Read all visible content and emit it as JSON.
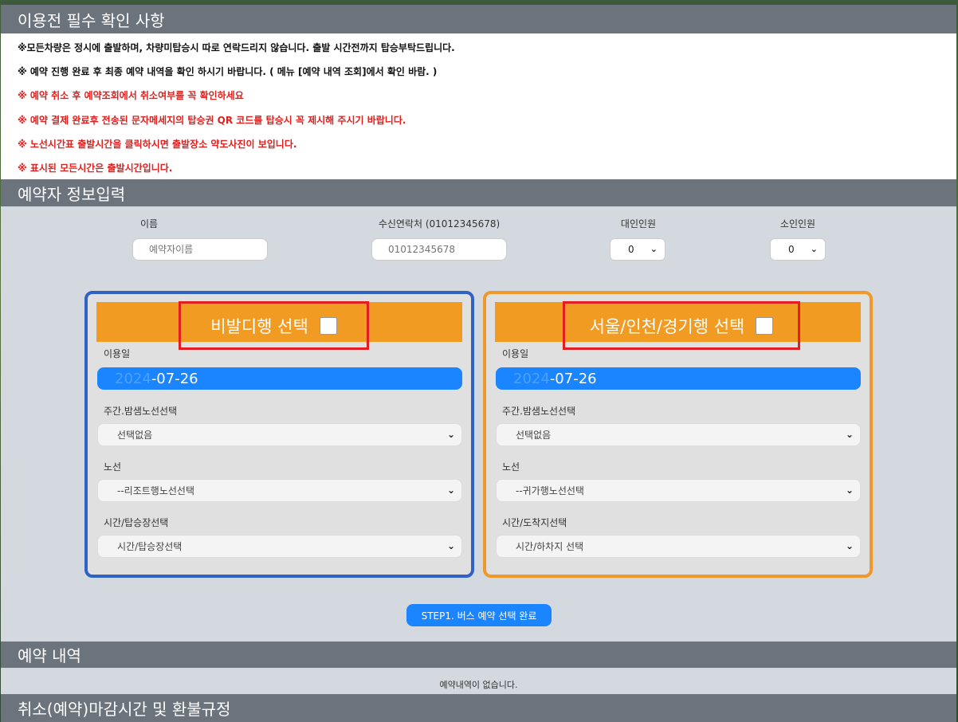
{
  "sections": {
    "notice_title": "이용전 필수 확인 사항",
    "info_title": "예약자 정보입력",
    "history_title": "예약 내역",
    "refund_title": "취소(예약)마감시간 및 환불규정"
  },
  "notices": [
    {
      "text": "※모든차량은 정시에 출발하며, 차량미탑승시 따로 연락드리지 않습니다. 출발 시간전까지 탑승부탁드립니다.",
      "color": "#111111"
    },
    {
      "text": "※ 예약 진행 완료 후 최종 예약 내역을 확인 하시기 바랍니다. ( 메뉴 [예약 내역 조회]에서 확인 바람. )",
      "color": "#111111"
    },
    {
      "text": "※ 예약 취소 후 예약조회에서 취소여부를 꼭 확인하세요",
      "color": "#e0201e"
    },
    {
      "text": "※ 예약 결제 완료후 전송된 문자메세지의 탑승권 QR 코드를 탑승시 꼭 제시해 주시기 바랍니다.",
      "color": "#e0201e"
    },
    {
      "text": "※ 노선시간표 출발시간을 클릭하시면 출발장소 약도사진이 보입니다.",
      "color": "#e0201e"
    },
    {
      "text": "※ 표시된 모든시간은 출발시간입니다.",
      "color": "#e0201e"
    }
  ],
  "form": {
    "name_label": "이름",
    "name_placeholder": "예약자이름",
    "phone_label": "수신연락처 (01012345678)",
    "phone_placeholder": "01012345678",
    "adult_label": "대인인원",
    "adult_value": "0",
    "child_label": "소인인원",
    "child_value": "0"
  },
  "left_box": {
    "title": "비발디행 선택",
    "date_label": "이용일",
    "date_year": "2024",
    "date_rest": "-07-26",
    "day_night_label": "주간.밤샘노선선택",
    "day_night_value": "선택없음",
    "route_label": "노선",
    "route_value": "--리조트행노선선택",
    "time_label": "시간/탑승장선택",
    "time_value": "시간/탑승장선택",
    "border_color": "#2f62c4"
  },
  "right_box": {
    "title": "서울/인천/경기행 선택",
    "date_label": "이용일",
    "date_year": "2024",
    "date_rest": "-07-26",
    "day_night_label": "주간.밤샘노선선택",
    "day_night_value": "선택없음",
    "route_label": "노선",
    "route_value": "--귀가행노선선택",
    "time_label": "시간/도착지선택",
    "time_value": "시간/하차지 선택",
    "border_color": "#f0982a"
  },
  "step_button": "STEP1. 버스 예약 선택 완료",
  "history_empty": "예약내역이 없습니다.",
  "icons": {
    "chevron": "chevron-down-icon"
  }
}
